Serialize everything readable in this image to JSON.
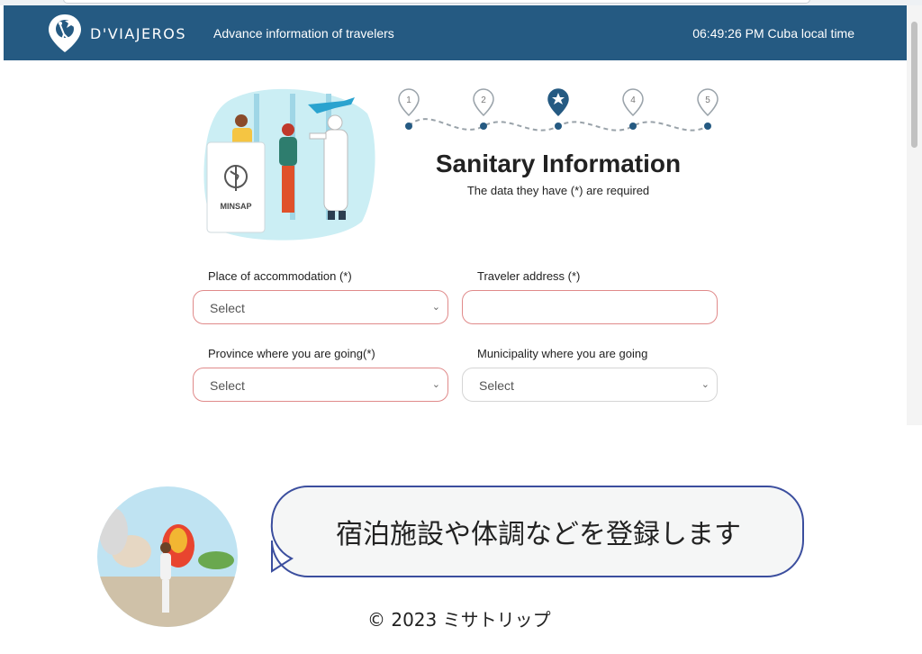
{
  "header": {
    "brand": "D'VIAJEROS",
    "tagline": "Advance information of travelers",
    "clock": "06:49:26 PM Cuba local time"
  },
  "illustration": {
    "sign_text": "MINSAP"
  },
  "steps": {
    "items": [
      "1",
      "2",
      "",
      "4",
      "5"
    ],
    "current_index": 3
  },
  "page": {
    "title": "Sanitary Information",
    "subtitle": "The data they have (*) are required"
  },
  "form": {
    "accommodation": {
      "label": "Place of accommodation (*)",
      "value": "Select"
    },
    "address": {
      "label": "Traveler address (*)",
      "value": ""
    },
    "province": {
      "label": "Province where you are going(*)",
      "value": "Select"
    },
    "municipality": {
      "label": "Municipality where you are going",
      "value": "Select"
    }
  },
  "caption": {
    "bubble_text": "宿泊施設や体調などを登録します",
    "copyright": "© 2023 ミサトリップ"
  },
  "colors": {
    "header_bg": "#255a82",
    "required_border": "#e08a8a",
    "step_accent": "#255a82",
    "bubble_border": "#3b4e9e"
  }
}
